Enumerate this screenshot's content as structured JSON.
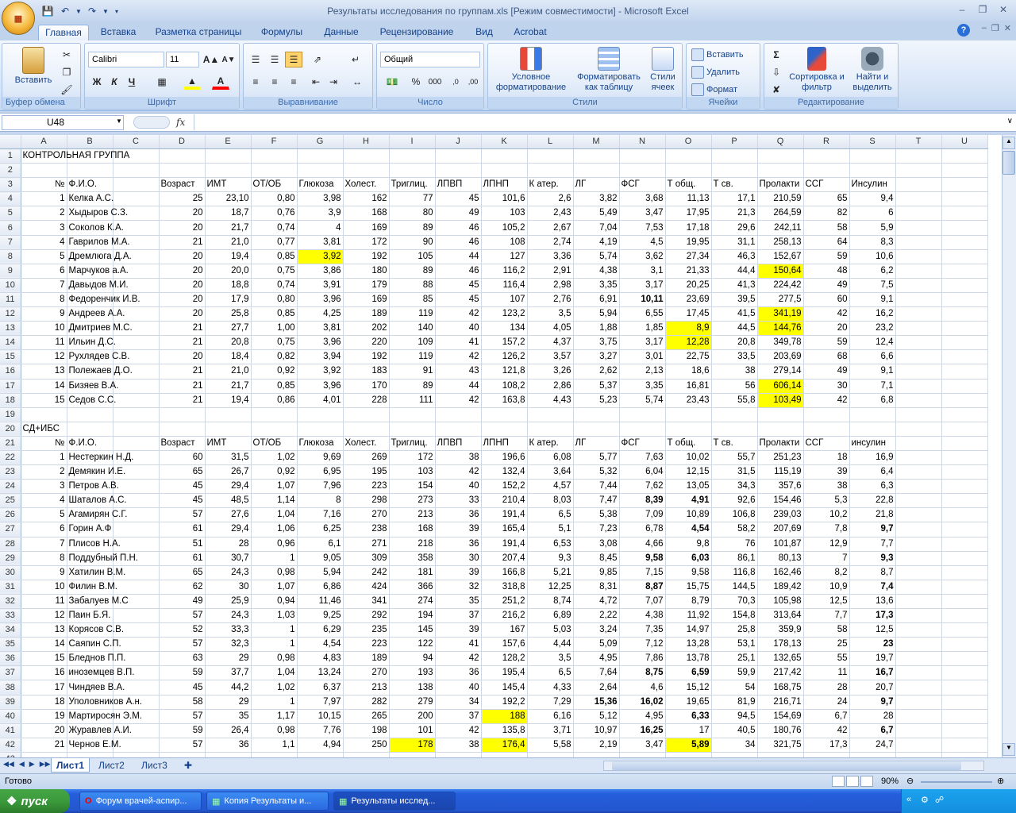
{
  "window": {
    "title": "Результаты исследования по группам.xls  [Режим совместимости] - Microsoft Excel"
  },
  "ribbon": {
    "tabs": [
      "Главная",
      "Вставка",
      "Разметка страницы",
      "Формулы",
      "Данные",
      "Рецензирование",
      "Вид",
      "Acrobat"
    ],
    "clipboard": {
      "paste": "Вставить",
      "label": "Буфер обмена"
    },
    "font": {
      "name": "Calibri",
      "size": "11",
      "label": "Шрифт"
    },
    "alignment": {
      "label": "Выравнивание"
    },
    "number": {
      "format": "Общий",
      "label": "Число",
      "pct": "%",
      "thousands": "000"
    },
    "styles": {
      "cond": "Условное форматирование",
      "astable": "Форматировать как таблицу",
      "cellstyles": "Стили ячеек",
      "label": "Стили"
    },
    "cells": {
      "insert": "Вставить",
      "delete": "Удалить",
      "format": "Формат",
      "label": "Ячейки"
    },
    "editing": {
      "sort": "Сортировка и фильтр",
      "find": "Найти и выделить",
      "label": "Редактирование"
    }
  },
  "formula_bar": {
    "cell_ref": "U48",
    "fx": "fx",
    "value": ""
  },
  "columns": [
    "A",
    "B",
    "C",
    "D",
    "E",
    "F",
    "G",
    "H",
    "I",
    "J",
    "K",
    "L",
    "M",
    "N",
    "O",
    "P",
    "Q",
    "R",
    "S",
    "T",
    "U"
  ],
  "sheet": {
    "title1": "КОНТРОЛЬНАЯ ГРУППА",
    "title2": "СД+ИБС",
    "header1": [
      "№",
      "Ф.И.О.",
      "Возраст",
      "ИМТ",
      "ОТ/ОБ",
      "Глюкоза",
      "Холест.",
      "Триглиц.",
      "ЛПВП",
      "ЛПНП",
      "К атер.",
      "ЛГ",
      "ФСГ",
      "Т общ.",
      "Т св.",
      "Пролакти",
      "ССГ",
      "Инсулин"
    ],
    "header2": [
      "№",
      "Ф.И.О.",
      "Возраст",
      "ИМТ",
      "ОТ/ОБ",
      "Глюкоза",
      "Холест.",
      "Триглиц.",
      "ЛПВП",
      "ЛПНП",
      "К атер.",
      "ЛГ",
      "ФСГ",
      "Т общ.",
      "Т св.",
      "Пролакти",
      "ССГ",
      "инсулин"
    ],
    "group1": [
      [
        "1",
        "Келка А.С.",
        "25",
        "23,10",
        "0,80",
        "3,98",
        "162",
        "77",
        "45",
        "101,6",
        "2,6",
        "3,82",
        "3,68",
        "11,13",
        "17,1",
        "210,59",
        "65",
        "9,4"
      ],
      [
        "2",
        "Хыдыров С.З.",
        "20",
        "18,7",
        "0,76",
        "3,9",
        "168",
        "80",
        "49",
        "103",
        "2,43",
        "5,49",
        "3,47",
        "17,95",
        "21,3",
        "264,59",
        "82",
        "6"
      ],
      [
        "3",
        "Соколов К.А.",
        "20",
        "21,7",
        "0,74",
        "4",
        "169",
        "89",
        "46",
        "105,2",
        "2,67",
        "7,04",
        "7,53",
        "17,18",
        "29,6",
        "242,11",
        "58",
        "5,9"
      ],
      [
        "4",
        "Гаврилов М.А.",
        "21",
        "21,0",
        "0,77",
        "3,81",
        "172",
        "90",
        "46",
        "108",
        "2,74",
        "4,19",
        "4,5",
        "19,95",
        "31,1",
        "258,13",
        "64",
        "8,3"
      ],
      [
        "5",
        "Дремлюга Д.А.",
        "20",
        "19,4",
        "0,85",
        "3,92",
        "192",
        "105",
        "44",
        "127",
        "3,36",
        "5,74",
        "3,62",
        "27,34",
        "46,3",
        "152,67",
        "59",
        "10,6"
      ],
      [
        "6",
        "Марчуков а.А.",
        "20",
        "20,0",
        "0,75",
        "3,86",
        "180",
        "89",
        "46",
        "116,2",
        "2,91",
        "4,38",
        "3,1",
        "21,33",
        "44,4",
        "150,64",
        "48",
        "6,2"
      ],
      [
        "7",
        "Давыдов М.И.",
        "20",
        "18,8",
        "0,74",
        "3,91",
        "179",
        "88",
        "45",
        "116,4",
        "2,98",
        "3,35",
        "3,17",
        "20,25",
        "41,3",
        "224,42",
        "49",
        "7,5"
      ],
      [
        "8",
        "Федоренчик И.В.",
        "20",
        "17,9",
        "0,80",
        "3,96",
        "169",
        "85",
        "45",
        "107",
        "2,76",
        "6,91",
        "10,11",
        "23,69",
        "39,5",
        "277,5",
        "60",
        "9,1"
      ],
      [
        "9",
        "Андреев А.А.",
        "20",
        "25,8",
        "0,85",
        "4,25",
        "189",
        "119",
        "42",
        "123,2",
        "3,5",
        "5,94",
        "6,55",
        "17,45",
        "41,5",
        "341,19",
        "42",
        "16,2"
      ],
      [
        "10",
        "Дмитриев М.С.",
        "21",
        "27,7",
        "1,00",
        "3,81",
        "202",
        "140",
        "40",
        "134",
        "4,05",
        "1,88",
        "1,85",
        "8,9",
        "44,5",
        "144,76",
        "20",
        "23,2"
      ],
      [
        "11",
        "Ильин Д.С.",
        "21",
        "20,8",
        "0,75",
        "3,96",
        "220",
        "109",
        "41",
        "157,2",
        "4,37",
        "3,75",
        "3,17",
        "12,28",
        "20,8",
        "349,78",
        "59",
        "12,4"
      ],
      [
        "12",
        "Рухлядев С.В.",
        "20",
        "18,4",
        "0,82",
        "3,94",
        "192",
        "119",
        "42",
        "126,2",
        "3,57",
        "3,27",
        "3,01",
        "22,75",
        "33,5",
        "203,69",
        "68",
        "6,6"
      ],
      [
        "13",
        "Полежаев Д.О.",
        "21",
        "21,0",
        "0,92",
        "3,92",
        "183",
        "91",
        "43",
        "121,8",
        "3,26",
        "2,62",
        "2,13",
        "18,6",
        "38",
        "279,14",
        "49",
        "9,1"
      ],
      [
        "14",
        "Бизяев В.А.",
        "21",
        "21,7",
        "0,85",
        "3,96",
        "170",
        "89",
        "44",
        "108,2",
        "2,86",
        "5,37",
        "3,35",
        "16,81",
        "56",
        "606,14",
        "30",
        "7,1"
      ],
      [
        "15",
        "Седов С.С.",
        "21",
        "19,4",
        "0,86",
        "4,01",
        "228",
        "111",
        "42",
        "163,8",
        "4,43",
        "5,23",
        "5,74",
        "23,43",
        "55,8",
        "103,49",
        "42",
        "6,8"
      ]
    ],
    "group2": [
      [
        "1",
        "Нестеркин Н.Д.",
        "60",
        "31,5",
        "1,02",
        "9,69",
        "269",
        "172",
        "38",
        "196,6",
        "6,08",
        "5,77",
        "7,63",
        "10,02",
        "55,7",
        "251,23",
        "18",
        "16,9"
      ],
      [
        "2",
        "Демякин И.Е.",
        "65",
        "26,7",
        "0,92",
        "6,95",
        "195",
        "103",
        "42",
        "132,4",
        "3,64",
        "5,32",
        "6,04",
        "12,15",
        "31,5",
        "115,19",
        "39",
        "6,4"
      ],
      [
        "3",
        "Петров А.В.",
        "45",
        "29,4",
        "1,07",
        "7,96",
        "223",
        "154",
        "40",
        "152,2",
        "4,57",
        "7,44",
        "7,62",
        "13,05",
        "34,3",
        "357,6",
        "38",
        "6,3"
      ],
      [
        "4",
        "Шаталов А.С.",
        "45",
        "48,5",
        "1,14",
        "8",
        "298",
        "273",
        "33",
        "210,4",
        "8,03",
        "7,47",
        "8,39",
        "4,91",
        "92,6",
        "154,46",
        "5,3",
        "22,8"
      ],
      [
        "5",
        "Агамирян С.Г.",
        "57",
        "27,6",
        "1,04",
        "7,16",
        "270",
        "213",
        "36",
        "191,4",
        "6,5",
        "5,38",
        "7,09",
        "10,89",
        "106,8",
        "239,03",
        "10,2",
        "21,8"
      ],
      [
        "6",
        "Горин А.Ф",
        "61",
        "29,4",
        "1,06",
        "6,25",
        "238",
        "168",
        "39",
        "165,4",
        "5,1",
        "7,23",
        "6,78",
        "4,54",
        "58,2",
        "207,69",
        "7,8",
        "9,7"
      ],
      [
        "7",
        "Плисов Н.А.",
        "51",
        "28",
        "0,96",
        "6,1",
        "271",
        "218",
        "36",
        "191,4",
        "6,53",
        "3,08",
        "4,66",
        "9,8",
        "76",
        "101,87",
        "12,9",
        "7,7"
      ],
      [
        "8",
        "Поддубный П.Н.",
        "61",
        "30,7",
        "1",
        "9,05",
        "309",
        "358",
        "30",
        "207,4",
        "9,3",
        "8,45",
        "9,58",
        "6,03",
        "86,1",
        "80,13",
        "7",
        "9,3"
      ],
      [
        "9",
        "Хатилин В.М.",
        "65",
        "24,3",
        "0,98",
        "5,94",
        "242",
        "181",
        "39",
        "166,8",
        "5,21",
        "9,85",
        "7,15",
        "9,58",
        "116,8",
        "162,46",
        "8,2",
        "8,7"
      ],
      [
        "10",
        "Филин В.М.",
        "62",
        "30",
        "1,07",
        "6,86",
        "424",
        "366",
        "32",
        "318,8",
        "12,25",
        "8,31",
        "8,87",
        "15,75",
        "144,5",
        "189,42",
        "10,9",
        "7,4"
      ],
      [
        "11",
        "Забалуев М.С",
        "49",
        "25,9",
        "0,94",
        "11,46",
        "341",
        "274",
        "35",
        "251,2",
        "8,74",
        "4,72",
        "7,07",
        "8,79",
        "70,3",
        "105,98",
        "12,5",
        "13,6"
      ],
      [
        "12",
        "Паин Б.Я.",
        "57",
        "24,3",
        "1,03",
        "9,25",
        "292",
        "194",
        "37",
        "216,2",
        "6,89",
        "2,22",
        "4,38",
        "11,92",
        "154,8",
        "313,64",
        "7,7",
        "17,3"
      ],
      [
        "13",
        "Корясов С.В.",
        "52",
        "33,3",
        "1",
        "6,29",
        "235",
        "145",
        "39",
        "167",
        "5,03",
        "3,24",
        "7,35",
        "14,97",
        "25,8",
        "359,9",
        "58",
        "12,5"
      ],
      [
        "14",
        "Саяпин С.П.",
        "57",
        "32,3",
        "1",
        "4,54",
        "223",
        "122",
        "41",
        "157,6",
        "4,44",
        "5,09",
        "7,12",
        "13,28",
        "53,1",
        "178,13",
        "25",
        "23"
      ],
      [
        "15",
        "Бледнов П.П.",
        "63",
        "29",
        "0,98",
        "4,83",
        "189",
        "94",
        "42",
        "128,2",
        "3,5",
        "4,95",
        "7,86",
        "13,78",
        "25,1",
        "132,65",
        "55",
        "19,7"
      ],
      [
        "16",
        "иноземцев В.П.",
        "59",
        "37,7",
        "1,04",
        "13,24",
        "270",
        "193",
        "36",
        "195,4",
        "6,5",
        "7,64",
        "8,75",
        "6,59",
        "59,9",
        "217,42",
        "11",
        "16,7"
      ],
      [
        "17",
        "Чиндяев В.А.",
        "45",
        "44,2",
        "1,02",
        "6,37",
        "213",
        "138",
        "40",
        "145,4",
        "4,33",
        "2,64",
        "4,6",
        "15,12",
        "54",
        "168,75",
        "28",
        "20,7"
      ],
      [
        "18",
        "Уполовников А.н.",
        "58",
        "29",
        "1",
        "7,97",
        "282",
        "279",
        "34",
        "192,2",
        "7,29",
        "15,36",
        "16,02",
        "19,65",
        "81,9",
        "216,71",
        "24",
        "9,7"
      ],
      [
        "19",
        "Мартиросян Э.М.",
        "57",
        "35",
        "1,17",
        "10,15",
        "265",
        "200",
        "37",
        "188",
        "6,16",
        "5,12",
        "4,95",
        "6,33",
        "94,5",
        "154,69",
        "6,7",
        "28"
      ],
      [
        "20",
        "Журавлев А.И.",
        "59",
        "26,4",
        "0,98",
        "7,76",
        "198",
        "101",
        "42",
        "135,8",
        "3,71",
        "10,97",
        "16,25",
        "17",
        "40,5",
        "180,76",
        "42",
        "6,7"
      ],
      [
        "21",
        "Чернов Е.М.",
        "57",
        "36",
        "1,1",
        "4,94",
        "250",
        "178",
        "38",
        "176,4",
        "5,58",
        "2,19",
        "3,47",
        "5,89",
        "34",
        "321,75",
        "17,3",
        "24,7"
      ]
    ]
  },
  "highlights": {
    "yellow_color": "#ffff00",
    "group1": [
      [
        5,
        5
      ],
      [
        6,
        15
      ],
      [
        9,
        15
      ],
      [
        10,
        15
      ],
      [
        10,
        13
      ],
      [
        11,
        13
      ],
      [
        14,
        15
      ],
      [
        15,
        15
      ]
    ],
    "group2": [
      [
        21,
        9
      ],
      [
        19,
        9
      ],
      [
        21,
        7
      ],
      [
        21,
        13
      ]
    ],
    "bold_group2": [
      [
        4,
        12
      ],
      [
        4,
        13
      ],
      [
        6,
        13
      ],
      [
        6,
        17
      ],
      [
        8,
        12
      ],
      [
        8,
        13
      ],
      [
        8,
        17
      ],
      [
        10,
        12
      ],
      [
        10,
        17
      ],
      [
        12,
        17
      ],
      [
        14,
        17
      ],
      [
        16,
        12
      ],
      [
        16,
        13
      ],
      [
        16,
        17
      ],
      [
        18,
        11
      ],
      [
        18,
        12
      ],
      [
        18,
        17
      ],
      [
        19,
        13
      ],
      [
        20,
        12
      ],
      [
        20,
        17
      ],
      [
        21,
        13
      ]
    ],
    "bold_group1": [
      [
        8,
        12
      ]
    ]
  },
  "sheet_tabs": [
    "Лист1",
    "Лист2",
    "Лист3"
  ],
  "status": {
    "ready": "Готово",
    "zoom": "90%"
  },
  "taskbar": {
    "start": "пуск",
    "tasks": [
      "Форум врачей-аспир...",
      "Копия Результаты и...",
      "Результаты исслед..."
    ]
  }
}
